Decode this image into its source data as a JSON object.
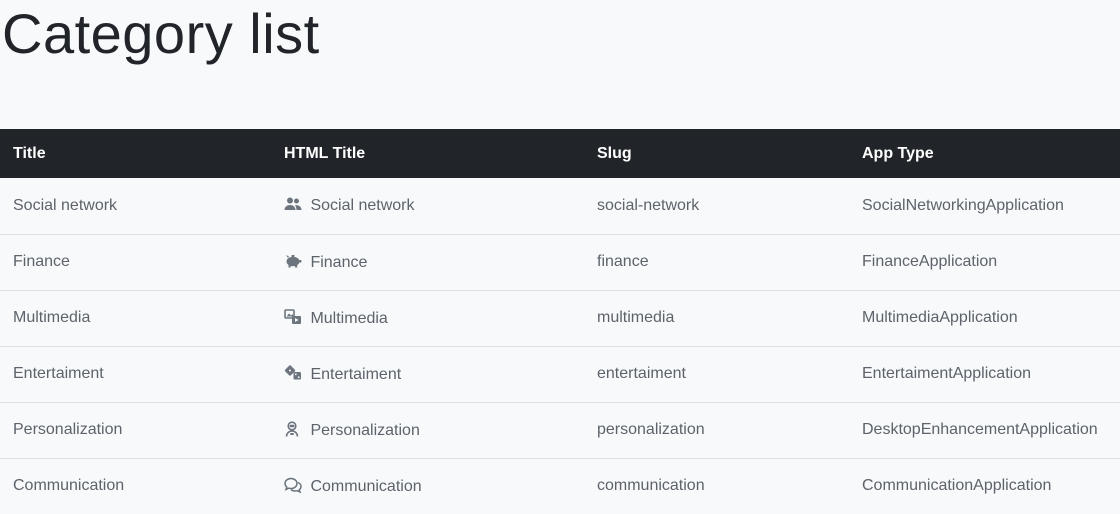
{
  "page": {
    "title": "Category list"
  },
  "table": {
    "headers": {
      "title": "Title",
      "html_title": "HTML Title",
      "slug": "Slug",
      "app_type": "App Type"
    },
    "rows": [
      {
        "title": "Social network",
        "icon": "users-icon",
        "html_title": "Social network",
        "slug": "social-network",
        "app_type": "SocialNetworkingApplication"
      },
      {
        "title": "Finance",
        "icon": "piggy-bank-icon",
        "html_title": "Finance",
        "slug": "finance",
        "app_type": "FinanceApplication"
      },
      {
        "title": "Multimedia",
        "icon": "photo-film-icon",
        "html_title": "Multimedia",
        "slug": "multimedia",
        "app_type": "MultimediaApplication"
      },
      {
        "title": "Entertaiment",
        "icon": "dice-icon",
        "html_title": "Entertaiment",
        "slug": "entertaiment",
        "app_type": "EntertaimentApplication"
      },
      {
        "title": "Personalization",
        "icon": "user-astronaut-icon",
        "html_title": "Personalization",
        "slug": "personalization",
        "app_type": "DesktopEnhancementApplication"
      },
      {
        "title": "Communication",
        "icon": "comments-icon",
        "html_title": "Communication",
        "slug": "communication",
        "app_type": "CommunicationApplication"
      }
    ]
  },
  "colors": {
    "header_bg": "#212529",
    "header_text": "#ffffff",
    "cell_text": "#5c636a",
    "page_bg": "#f8f9fb",
    "row_border": "#dee2e6"
  }
}
